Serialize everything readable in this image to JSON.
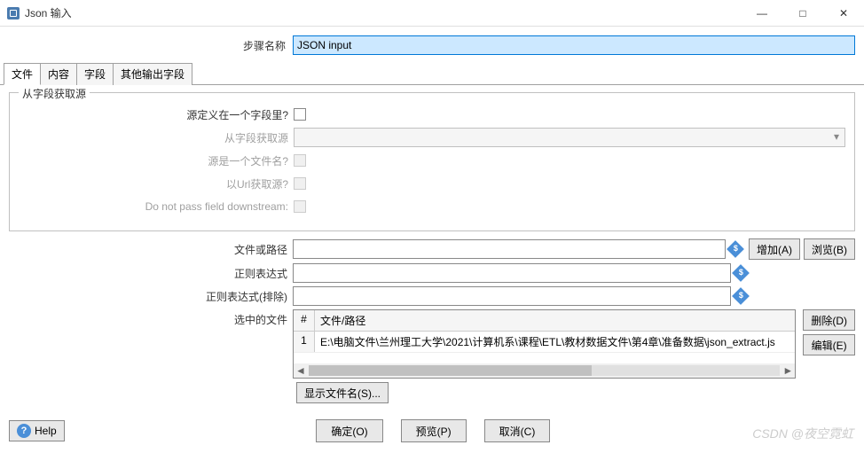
{
  "window": {
    "title": "Json 输入",
    "minimize": "—",
    "maximize": "□",
    "close": "✕"
  },
  "step": {
    "label": "步骤名称",
    "value": "JSON input"
  },
  "tabs": [
    "文件",
    "内容",
    "字段",
    "其他输出字段"
  ],
  "fieldset": {
    "title": "从字段获取源",
    "rows": {
      "source_in_field": "源定义在一个字段里?",
      "get_from_field": "从字段获取源",
      "source_is_filename": "源是一个文件名?",
      "get_from_url": "以Url获取源?",
      "do_not_pass": "Do not pass field downstream:"
    }
  },
  "file_or_path": {
    "label": "文件或路径",
    "add_btn": "增加(A)",
    "browse_btn": "浏览(B)"
  },
  "regex": {
    "label": "正则表达式"
  },
  "regex_exclude": {
    "label": "正则表达式(排除)"
  },
  "selected_files": {
    "label": "选中的文件",
    "col_num": "#",
    "col_path": "文件/路径",
    "rows": [
      {
        "num": "1",
        "path": "E:\\电脑文件\\兰州理工大学\\2021\\计算机系\\课程\\ETL\\教材数据文件\\第4章\\准备数据\\json_extract.js"
      }
    ],
    "delete_btn": "删除(D)",
    "edit_btn": "编辑(E)"
  },
  "show_filename_btn": "显示文件名(S)...",
  "buttons": {
    "help": "Help",
    "ok": "确定(O)",
    "preview": "预览(P)",
    "cancel": "取消(C)"
  },
  "watermark": "CSDN @夜空霓虹"
}
